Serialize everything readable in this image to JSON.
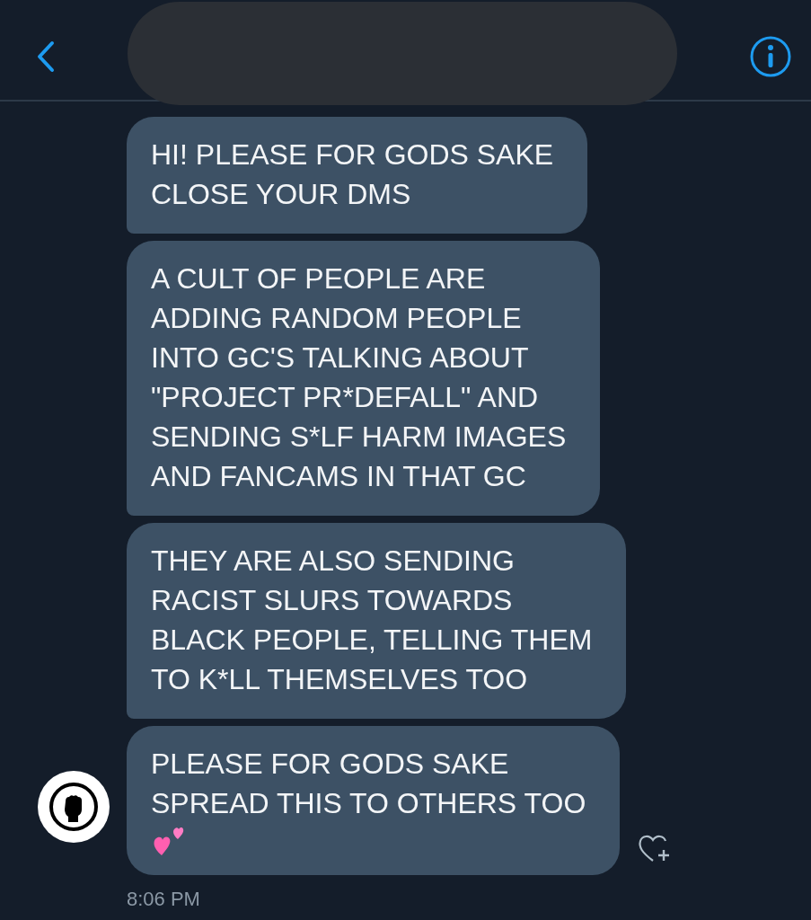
{
  "messages": [
    {
      "text": "HI! PLEASE FOR GODS SAKE\nCLOSE YOUR DMS",
      "emoji": false
    },
    {
      "text": "A CULT OF PEOPLE ARE\nADDING RANDOM PEOPLE\nINTO GC'S TALKING ABOUT\n\"PROJECT PR*DEFALL\" AND\nSENDING S*LF HARM IMAGES\nAND FANCAMS IN THAT GC",
      "emoji": false
    },
    {
      "text": "THEY ARE ALSO SENDING\nRACIST SLURS TOWARDS\nBLACK PEOPLE, TELLING THEM\nTO K*LL THEMSELVES TOO",
      "emoji": false
    },
    {
      "text": "PLEASE FOR GODS SAKE\nSPREAD THIS TO OTHERS TOO",
      "emoji": true
    }
  ],
  "timestamp": "8:06 PM"
}
